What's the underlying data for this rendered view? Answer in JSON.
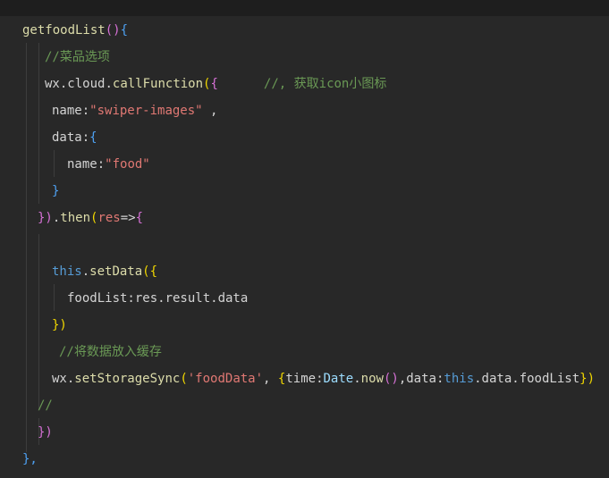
{
  "code": {
    "l1_fn": "getfoodList",
    "l1_paren": "()",
    "l1_brace": "{",
    "l2_comment": "//菜品选项",
    "l3_obj": "wx",
    "l3_dot1": ".",
    "l3_obj2": "cloud",
    "l3_dot2": ".",
    "l3_fn": "callFunction",
    "l3_paren": "(",
    "l3_brace": "{",
    "l3_comment": "//, 获取icon小图标",
    "l4_key": "name",
    "l4_colon": ":",
    "l4_str": "\"swiper-images\"",
    "l4_comma": " ,",
    "l5_key": "data",
    "l5_colon": ":",
    "l5_brace": "{",
    "l6_key": "name",
    "l6_colon": ":",
    "l6_str": "\"food\"",
    "l7_brace": "}",
    "l8_close": "})",
    "l8_dot": ".",
    "l8_fn": "then",
    "l8_paren": "(",
    "l8_arg": "res",
    "l8_arrow": "=>",
    "l8_brace": "{",
    "l10_this": "this",
    "l10_dot": ".",
    "l10_fn": "setData",
    "l10_paren": "(",
    "l10_brace": "{",
    "l11_text": "foodList:res.result.data",
    "l12_close": "})",
    "l13_comment": "//将数据放入缓存",
    "l14_obj": "wx",
    "l14_dot": ".",
    "l14_fn": "setStorageSync",
    "l14_paren": "(",
    "l14_str": "'foodData'",
    "l14_comma": ", ",
    "l14_brace": "{",
    "l14_key1": "time",
    "l14_colon1": ":",
    "l14_cls": "Date",
    "l14_dot2": ".",
    "l14_fn2": "now",
    "l14_paren2": "()",
    "l14_comma2": ",",
    "l14_key2": "data",
    "l14_colon2": ":",
    "l14_this": "this",
    "l14_rest": ".data.foodList",
    "l14_close": "})",
    "l15_comment": "//",
    "l16_close": "})",
    "l17_close": "},"
  }
}
